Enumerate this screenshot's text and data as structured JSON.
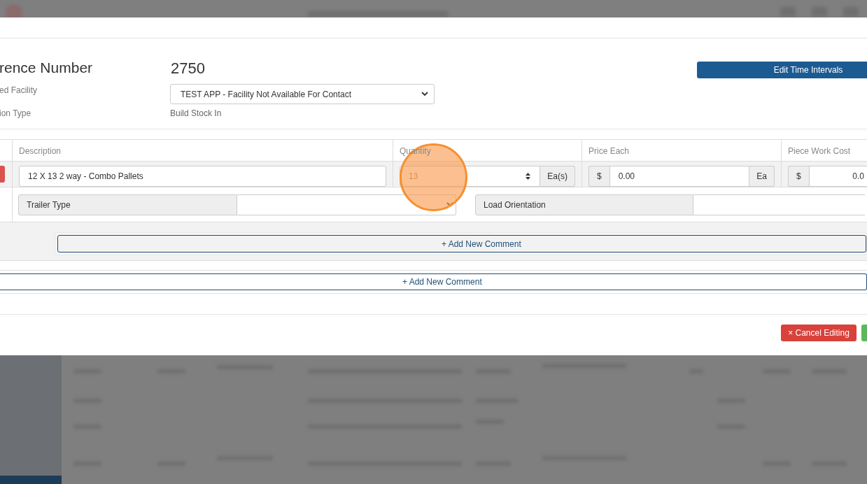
{
  "header": {
    "reference_label": "rence Number",
    "reference_value": "2750",
    "facility_label": "ed Facility",
    "facility_value": "TEST APP - Facility Not Available For Contact",
    "type_label": "ion Type",
    "type_value": "Build Stock In",
    "edit_button": "Edit Time Intervals"
  },
  "table": {
    "columns": [
      "Description",
      "Quantity",
      "Price Each",
      "Piece Work Cost"
    ],
    "line": {
      "description": "12 X 13 2 way - Combo Pallets",
      "quantity": "13",
      "quantity_unit": "Ea(s)",
      "price_prefix": "$",
      "price": "0.00",
      "price_unit": "Ea",
      "cost_prefix": "$",
      "cost": "0.0"
    },
    "attributes": [
      {
        "label": "Trailer Type",
        "kind": "select"
      },
      {
        "label": "Load Orientation",
        "kind": "text"
      }
    ],
    "line_comment_button": "+ Add New Comment"
  },
  "comment_button": "+ Add New Comment",
  "footer": {
    "cancel_button": "× Cancel Editing"
  }
}
